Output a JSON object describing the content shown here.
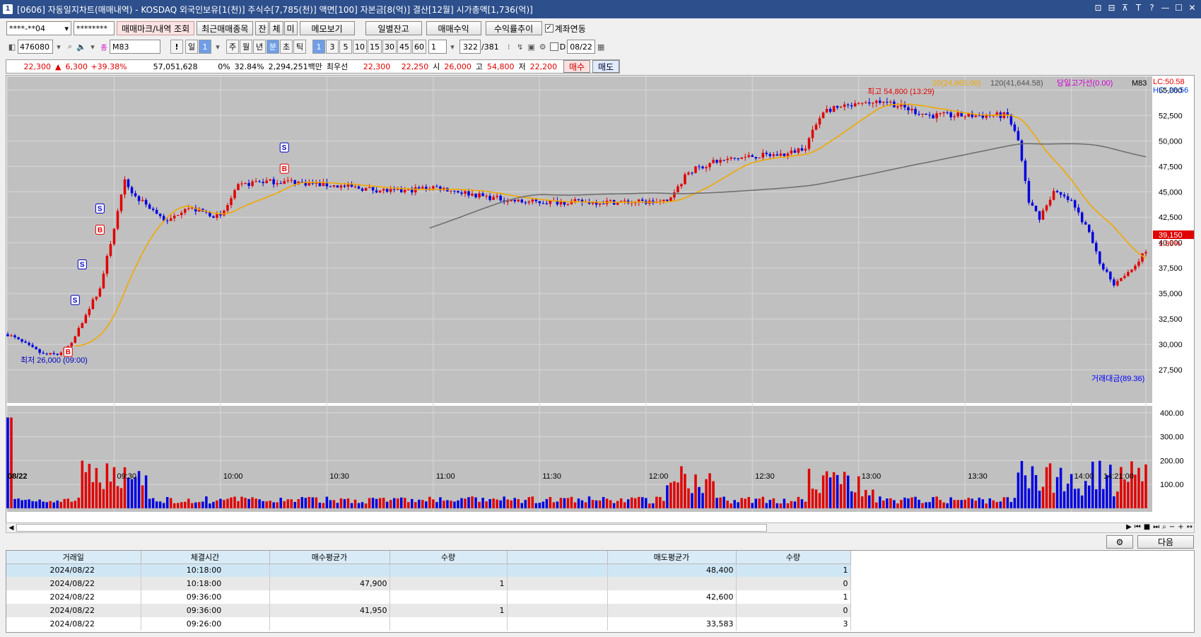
{
  "window": {
    "title": "[0606] 자동일지차트(매매내역) - KOSDAQ 외국인보유[1(천)] 주식수[7,785(천)] 액면[100] 자본금[8(억)] 결산[12월] 시가총액[1,736(억)]",
    "icon_label": "1",
    "buttons": [
      "⊡",
      "⊟",
      "⊼",
      "T",
      "?",
      "—",
      "☐",
      "✕"
    ]
  },
  "toolbar1": {
    "account": "****-**04",
    "password": "********",
    "btn_mark": "매매마크/내역 조회",
    "btn_recent": "최근매매종목",
    "btn_jan": "잔",
    "btn_che": "체",
    "btn_mi": "미",
    "btn_memo": "메모보기",
    "btn_daily": "일별잔고",
    "btn_profit": "매매수익",
    "btn_rate": "수익률추이",
    "link_label": "계좌연동"
  },
  "toolbar2": {
    "code": "476080",
    "stock_name": "M83",
    "period_label": "일",
    "period_value": "1",
    "periods": [
      "주",
      "월",
      "년",
      "분",
      "초",
      "틱"
    ],
    "intervals": [
      "1",
      "3",
      "5",
      "10",
      "15",
      "30",
      "45",
      "60"
    ],
    "interval_value": "1",
    "count": "322",
    "count_total": "/381",
    "d_label": "D",
    "date": "08/22"
  },
  "quote": {
    "price": "22,300",
    "change": "6,300",
    "change_pct": "+39.38%",
    "volume": "57,051,628",
    "ratio1": "0%",
    "ratio2": "32.84%",
    "amount": "2,294,251백만",
    "best_label": "최우선",
    "ask": "22,300",
    "bid": "22,250",
    "open_label": "시",
    "open": "26,000",
    "high_label": "고",
    "high": "54,800",
    "low_label": "저",
    "low": "22,200",
    "buy_btn": "매수",
    "sell_btn": "매도"
  },
  "chart_labels": {
    "ma20": "20(24,665.00)",
    "ma120": "120(41,644.58)",
    "intraday_high_line": "당일고가선(0.00)",
    "stock": "M83",
    "lc": "LC:50.58",
    "hc": "HC:-28.56",
    "high_ann": "최고 54,800 (13:29)",
    "low_ann": "최저 26,000 (09:00)",
    "last_price": "39,150",
    "last_pct": "1.95%",
    "volume_legend": "거래대금(89.36)",
    "date_label": "08/22"
  },
  "chart_data": {
    "type": "candlestick",
    "price_axis": [
      "55,000",
      "52,500",
      "50,000",
      "47,500",
      "45,000",
      "42,500",
      "40,000",
      "37,500",
      "35,000",
      "32,500",
      "30,000",
      "27,500"
    ],
    "volume_axis": [
      "400.00",
      "300.00",
      "200.00",
      "100.00"
    ],
    "time_axis": [
      "09:30",
      "10:00",
      "10:30",
      "11:00",
      "11:30",
      "12:00",
      "12:30",
      "13:00",
      "13:30",
      "14:00",
      "14:21:00"
    ],
    "ylim": [
      25000,
      56000
    ],
    "trade_marks": [
      {
        "type": "B",
        "time": "09:17"
      },
      {
        "type": "S",
        "time": "09:19"
      },
      {
        "type": "S",
        "time": "09:21"
      },
      {
        "type": "B",
        "time": "09:26"
      },
      {
        "type": "S",
        "time": "09:26"
      },
      {
        "type": "B",
        "time": "10:18"
      },
      {
        "type": "S",
        "time": "10:18"
      }
    ]
  },
  "grid": {
    "headers": [
      "거래일",
      "체결시간",
      "매수평균가",
      "수량",
      "",
      "매도평균가",
      "수량"
    ],
    "rows": [
      [
        "2024/08/22",
        "10:18:00",
        "",
        "",
        "",
        "48,400",
        "1"
      ],
      [
        "2024/08/22",
        "10:18:00",
        "47,900",
        "1",
        "",
        "",
        "0"
      ],
      [
        "2024/08/22",
        "09:36:00",
        "",
        "",
        "",
        "42,600",
        "1"
      ],
      [
        "2024/08/22",
        "09:36:00",
        "41,950",
        "1",
        "",
        "",
        "0"
      ],
      [
        "2024/08/22",
        "09:26:00",
        "",
        "",
        "",
        "33,583",
        "3"
      ]
    ],
    "next_btn": "다음"
  }
}
